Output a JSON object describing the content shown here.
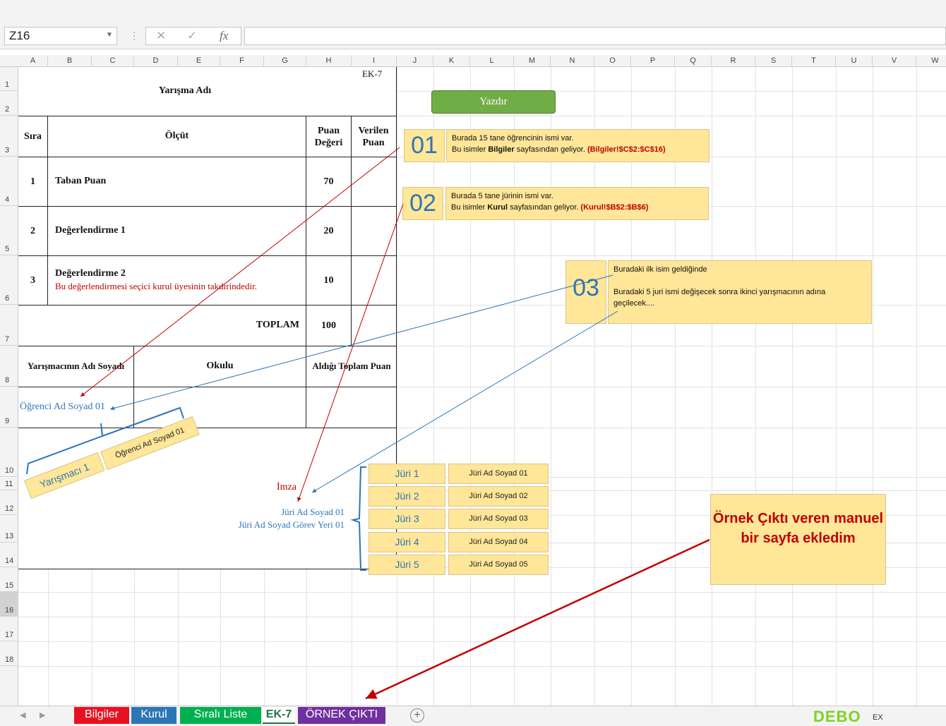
{
  "formula_bar": {
    "name_box": "Z16",
    "cancel_glyph": "✕",
    "enter_glyph": "✓",
    "fx_glyph": "fx",
    "formula": ""
  },
  "columns": [
    "A",
    "B",
    "C",
    "D",
    "E",
    "F",
    "G",
    "H",
    "I",
    "J",
    "K",
    "L",
    "M",
    "N",
    "O",
    "P",
    "Q",
    "R",
    "S",
    "T",
    "U",
    "V",
    "W"
  ],
  "rows": [
    "1",
    "2",
    "3",
    "4",
    "5",
    "6",
    "7",
    "8",
    "9",
    "10",
    "11",
    "12",
    "13",
    "14",
    "15",
    "16",
    "17",
    "18"
  ],
  "form": {
    "ek": "EK-7",
    "title": "Yarışma Adı",
    "headers": {
      "sira": "Sıra",
      "olcut": "Ölçüt",
      "puan_degeri": "Puan Değeri",
      "verilen_puan": "Verilen Puan"
    },
    "criteria": [
      {
        "sira": "1",
        "name": "Taban Puan",
        "note": "",
        "puan": "70"
      },
      {
        "sira": "2",
        "name": "Değerlendirme 1",
        "note": "",
        "puan": "20"
      },
      {
        "sira": "3",
        "name": "Değerlendirme 2",
        "note": "Bu değerlendirmesi seçici kurul üyesinin takdirindedir.",
        "puan": "10"
      }
    ],
    "toplam_label": "TOPLAM",
    "toplam_value": "100",
    "contestant_headers": {
      "name": "Yarışmacının Adı Soyadı",
      "school": "Okulu",
      "total": "Aldığı Toplam Puan"
    },
    "contestant_name": "Öğrenci Ad Soyad 01",
    "imza": "İmza",
    "juri_name": "Jüri Ad Soyad 01",
    "juri_place": "Jüri Ad Soyad Görev Yeri 01"
  },
  "print_button": "Yazdır",
  "notes": [
    {
      "num": "01",
      "line1": "Burada 15 tane öğrencinin ismi var.",
      "line2_pre": "Bu isimler ",
      "line2_bold": "Bilgiler",
      "line2_post": " sayfasından geliyor. ",
      "ref": "(Bilgiler!$C$2:$C$16)"
    },
    {
      "num": "02",
      "line1": "Burada 5 tane jürinin ismi var.",
      "line2_pre": "Bu isimler ",
      "line2_bold": "Kurul",
      "line2_post": " sayfasından geliyor. ",
      "ref": "(Kurul!$B$2:$B$6)"
    },
    {
      "num": "03",
      "line1": "Buradaki ilk isim geldiğinde",
      "line2": "Buradaki 5 juri ismi değişecek sonra ikinci yarışmacının adına geçilecek...."
    }
  ],
  "contestant_labels": {
    "label": "Yarışmacı 1",
    "name": "Öğrenci Ad Soyad 01"
  },
  "juries": [
    {
      "label": "Jüri 1",
      "name": "Jüri Ad Soyad 01"
    },
    {
      "label": "Jüri 2",
      "name": "Jüri Ad Soyad 02"
    },
    {
      "label": "Jüri 3",
      "name": "Jüri Ad Soyad 03"
    },
    {
      "label": "Jüri 4",
      "name": "Jüri Ad Soyad 04"
    },
    {
      "label": "Jüri 5",
      "name": "Jüri Ad Soyad 05"
    }
  ],
  "sample_note": "Örnek Çıktı veren manuel bir sayfa ekledim",
  "tabs": [
    {
      "label": "Bilgiler",
      "color": "#e81123"
    },
    {
      "label": "Kurul",
      "color": "#2e75b6"
    },
    {
      "label": "Sıralı Liste",
      "color": "#00b050"
    },
    {
      "label": "EK-7",
      "color": "#ffffff"
    },
    {
      "label": "ÖRNEK ÇIKTI",
      "color": "#7030a0"
    }
  ],
  "tab_add": "+",
  "logo": "DEBO",
  "logo_small": "EX"
}
